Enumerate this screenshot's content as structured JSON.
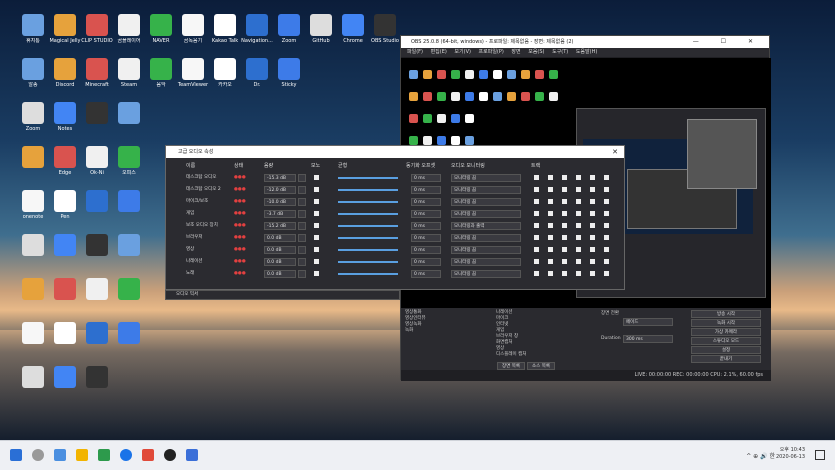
{
  "obs": {
    "title": "OBS 25.0.8 (64-bit, windows) - 프로파일: 제목없음 - 장면: 제목없음 (2)",
    "menu": "파일(F)  편집(E)  보기(V)  프로파일(P)  장면 모음(S)  도구(T)  도움말(H)",
    "status": "LIVE: 00:00:00   REC: 00:00:00   CPU: 2.1%, 60.00 fps",
    "window_controls": "—  ☐  ✕",
    "docks": {
      "scene_col": [
        "영상통화",
        "영상인터뷰",
        "영상녹화",
        "녹화"
      ],
      "sources": [
        "나레이션",
        "마이크",
        "인터넷",
        "게임",
        "브라우저 창",
        "화면캡처",
        "영상",
        "디스플레이 캡처"
      ],
      "transition_label": "장면 전환",
      "fade": "페이드",
      "duration_label": "Duration",
      "duration_value": "300 ms",
      "controls": [
        "방송 시작",
        "녹화 시작",
        "가상 카메라",
        "스튜디오 모드",
        "설정",
        "끝내기"
      ],
      "tab_sources": "장면 목록",
      "tab_mixer": "소스 목록"
    }
  },
  "advanced_audio": {
    "title": "고급 오디오 속성",
    "headers": [
      "이름",
      "상태",
      "음량",
      "모노",
      "균형",
      "동기화 오프셋",
      "오디오 모니터링",
      "트랙"
    ],
    "rows": [
      {
        "name": "데스크탑 오디오",
        "db": "-15.3 dB",
        "offset": "0 ms",
        "monitor": "모니터링 끔"
      },
      {
        "name": "데스크탑 오디오 2",
        "db": "-12.0 dB",
        "offset": "0 ms",
        "monitor": "모니터링 끔"
      },
      {
        "name": "마이크/보조",
        "db": "-10.0 dB",
        "offset": "0 ms",
        "monitor": "모니터링 끔"
      },
      {
        "name": "게임",
        "db": "-3.7 dB",
        "offset": "0 ms",
        "monitor": "모니터링 끔"
      },
      {
        "name": "보조 오디오 장치",
        "db": "-15.2 dB",
        "offset": "0 ms",
        "monitor": "모니터링과 출력"
      },
      {
        "name": "브라우저",
        "db": "0.0 dB",
        "offset": "0 ms",
        "monitor": "모니터링 끔"
      },
      {
        "name": "영상",
        "db": "0.0 dB",
        "offset": "0 ms",
        "monitor": "모니터링 끔"
      },
      {
        "name": "나레이션",
        "db": "0.0 dB",
        "offset": "0 ms",
        "monitor": "모니터링 끔"
      },
      {
        "name": "노래",
        "db": "0.0 dB",
        "offset": "0 ms",
        "monitor": "모니터링 끔"
      }
    ],
    "close": "✕"
  },
  "mixer_dock": "오디오 믹서",
  "desktop_icons": [
    "휴지통",
    "Magical Jelly",
    "CLIP STUDIO",
    "곰플레이어",
    "NAVER",
    "곰녹음기",
    "Kakao Talk",
    "Navigation...",
    "Zoom",
    "GitHub",
    "Chrome",
    "OBS Studio",
    "알송",
    "Discord",
    "Minecraft",
    "Steam",
    "음악",
    "TeamViewer",
    "카카오",
    "Dr.",
    "Sticky",
    "Zoom",
    "Notes",
    "",
    "",
    "",
    "Edge",
    "Ok-Ni",
    "오피스",
    "onenote",
    "Pen",
    "",
    "",
    ""
  ],
  "taskbar": {
    "tray": "^  ⊕  🔊  한",
    "time": "오후 10:43",
    "date": "2020-06-13"
  },
  "colors": {
    "obs_bg": "#1f1f23",
    "accent": "#5a9fe0",
    "red": "#e34040"
  }
}
